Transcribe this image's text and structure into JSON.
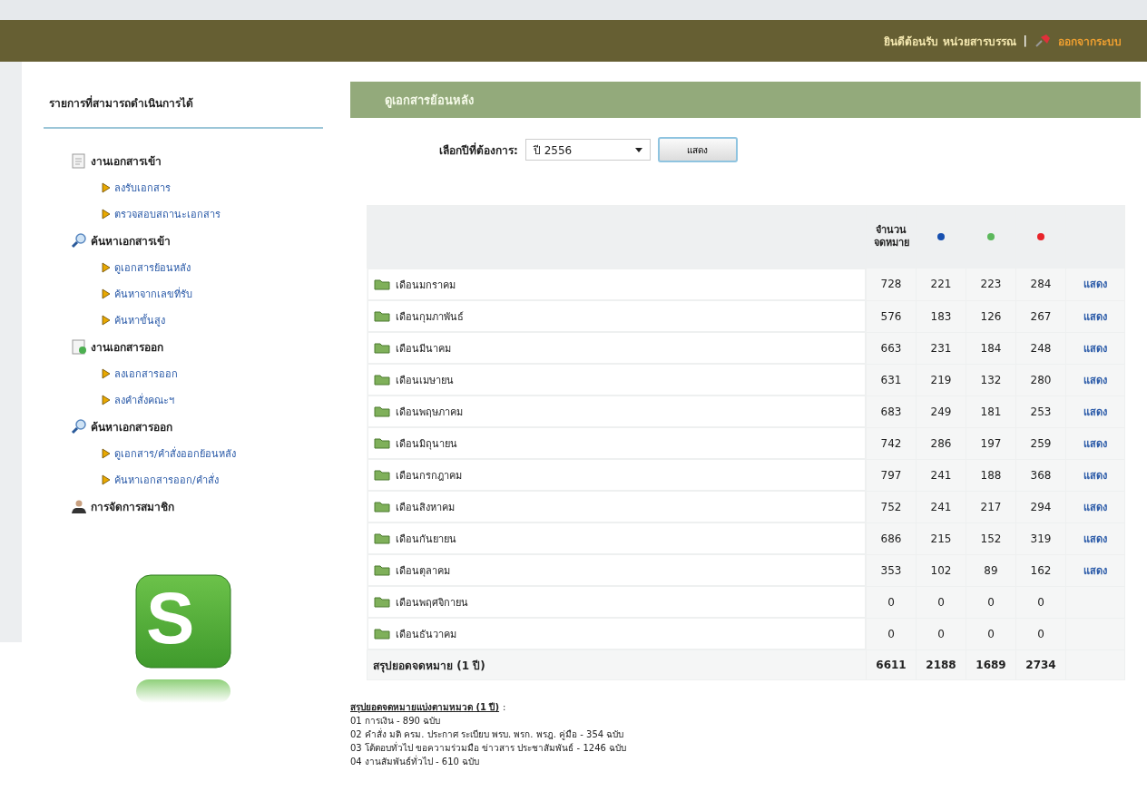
{
  "header": {
    "welcome": "ยินดีต้อนรับ หน่วยสารบรรณ",
    "separator": "|",
    "logout": "ออกจากระบบ"
  },
  "sidebar": {
    "title": "รายการที่สามารถดำเนินการได้",
    "groups": [
      {
        "label": "งานเอกสารเข้า",
        "kind": "document",
        "children": [
          {
            "label": "ลงรับเอกสาร"
          },
          {
            "label": "ตรวจสอบสถานะเอกสาร"
          }
        ]
      },
      {
        "label": "ค้นหาเอกสารเข้า",
        "kind": "search",
        "children": [
          {
            "label": "ดูเอกสารย้อนหลัง"
          },
          {
            "label": "ค้นหาจากเลขที่รับ"
          },
          {
            "label": "ค้นหาขั้นสูง"
          }
        ]
      },
      {
        "label": "งานเอกสารออก",
        "kind": "outgoing",
        "children": [
          {
            "label": "ลงเอกสารออก"
          },
          {
            "label": "ลงคำสั่งคณะฯ"
          }
        ]
      },
      {
        "label": "ค้นหาเอกสารออก",
        "kind": "search",
        "children": [
          {
            "label": "ดูเอกสาร/คำสั่งออกย้อนหลัง"
          },
          {
            "label": "ค้นหาเอกสารออก/คำสั่ง"
          }
        ]
      },
      {
        "label": "การจัดการสมาชิก",
        "kind": "users"
      }
    ],
    "logo": {
      "letter": "S"
    }
  },
  "panel": {
    "title": "ดูเอกสารย้อนหลัง",
    "year_label": "เลือกปีที่ต้องการ:",
    "year_value": "ปี 2556",
    "show_button": "แสดง"
  },
  "table": {
    "columns": [
      {
        "label": "จำนวน จดหมาย"
      },
      {
        "color": "#1750b0"
      },
      {
        "color": "#5cb85c"
      },
      {
        "color": "#e8242a"
      }
    ],
    "rows": [
      {
        "month": "เดือนมกราคม",
        "values": [
          "728",
          "221",
          "223",
          "284"
        ],
        "action": "แสดง"
      },
      {
        "month": "เดือนกุมภาพันธ์",
        "values": [
          "576",
          "183",
          "126",
          "267"
        ],
        "action": "แสดง"
      },
      {
        "month": "เดือนมีนาคม",
        "values": [
          "663",
          "231",
          "184",
          "248"
        ],
        "action": "แสดง"
      },
      {
        "month": "เดือนเมษายน",
        "values": [
          "631",
          "219",
          "132",
          "280"
        ],
        "action": "แสดง"
      },
      {
        "month": "เดือนพฤษภาคม",
        "values": [
          "683",
          "249",
          "181",
          "253"
        ],
        "action": "แสดง"
      },
      {
        "month": "เดือนมิถุนายน",
        "values": [
          "742",
          "286",
          "197",
          "259"
        ],
        "action": "แสดง"
      },
      {
        "month": "เดือนกรกฎาคม",
        "values": [
          "797",
          "241",
          "188",
          "368"
        ],
        "action": "แสดง"
      },
      {
        "month": "เดือนสิงหาคม",
        "values": [
          "752",
          "241",
          "217",
          "294"
        ],
        "action": "แสดง"
      },
      {
        "month": "เดือนกันยายน",
        "values": [
          "686",
          "215",
          "152",
          "319"
        ],
        "action": "แสดง"
      },
      {
        "month": "เดือนตุลาคม",
        "values": [
          "353",
          "102",
          "89",
          "162"
        ],
        "action": "แสดง"
      },
      {
        "month": "เดือนพฤศจิกายน",
        "values": [
          "0",
          "0",
          "0",
          "0"
        ]
      },
      {
        "month": "เดือนธันวาคม",
        "values": [
          "0",
          "0",
          "0",
          "0"
        ]
      }
    ],
    "total": {
      "label": "สรุปยอดจดหมาย (1 ปี)",
      "values": [
        "6611",
        "2188",
        "1689",
        "2734"
      ]
    }
  },
  "summary": {
    "title": "สรุปยอดจดหมายแบ่งตามหมวด (1 ปี)",
    "colon": ":",
    "lines": [
      "01 การเงิน - 890 ฉบับ",
      "02 คำสั่ง มติ ครม. ประกาศ ระเบียบ พรบ. พรก. พรฎ. คู่มือ - 354 ฉบับ",
      "03 โต้ตอบทั่วไป ขอความร่วมมือ ข่าวสาร ประชาสัมพันธ์ - 1246 ฉบับ",
      "04 งานสัมพันธ์ทั่วไป - 610 ฉบับ"
    ]
  }
}
